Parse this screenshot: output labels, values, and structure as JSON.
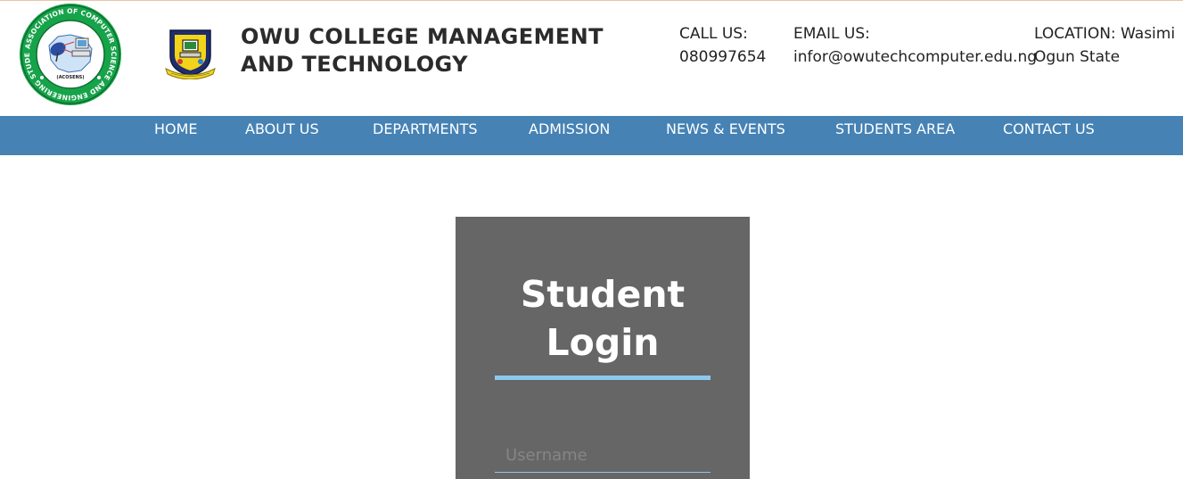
{
  "header": {
    "college_name": "OWU COLLEGE MANAGEMENT AND TECHNOLOGY",
    "association_logo_text": "ASSOCIATION OF COMPUTER SCIENCE AND ENGINEERING STUDENTS",
    "association_logo_abbrev": "(ACOSENS)",
    "contacts": {
      "call_label": "CALL US:",
      "call_value": "080997654",
      "email_label": "EMAIL US:",
      "email_value": "infor@owutechcomputer.edu.ng",
      "location_label": "LOCATION: Wasimi",
      "location_value": "Ogun State"
    }
  },
  "nav": {
    "items": [
      {
        "label": "HOME"
      },
      {
        "label": "ABOUT US"
      },
      {
        "label": "DEPARTMENTS"
      },
      {
        "label": "ADMISSION"
      },
      {
        "label": "NEWS & EVENTS"
      },
      {
        "label": "STUDENTS AREA"
      },
      {
        "label": "CONTACT US"
      }
    ]
  },
  "login": {
    "title_line1": "Student",
    "title_line2": "Login",
    "username_placeholder": "Username",
    "username_value": ""
  },
  "colors": {
    "nav_bg": "#4682b4",
    "card_bg": "#666666",
    "accent": "#8cc8ee",
    "logo_green": "#17a34a",
    "crest_navy": "#1f2d6b",
    "crest_gold": "#f2d41a"
  },
  "icons": {
    "association_logo": "association-emblem",
    "college_crest": "college-crest"
  }
}
